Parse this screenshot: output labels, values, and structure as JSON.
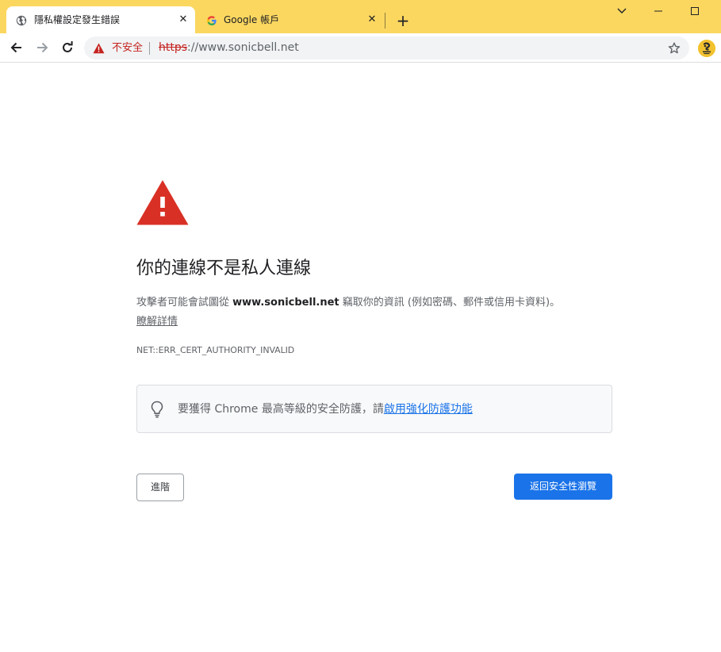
{
  "tabs": [
    {
      "title": "隱私權設定發生錯誤",
      "icon": "globe-icon",
      "active": true
    },
    {
      "title": "Google 帳戶",
      "icon": "google-g-icon",
      "active": false
    }
  ],
  "toolbar": {
    "security_label": "不安全",
    "url_scheme": "https",
    "url_rest": "://www.sonicbell.net"
  },
  "interstitial": {
    "heading": "你的連線不是私人連線",
    "explanation_before": "攻擊者可能會試圖從 ",
    "explanation_host": "www.sonicbell.net",
    "explanation_after": " 竊取你的資訊 (例如密碼、郵件或信用卡資料)。",
    "learn_more": "瞭解詳情",
    "error_code": "NET::ERR_CERT_AUTHORITY_INVALID",
    "promo_text": "要獲得 Chrome 最高等級的安全防護，請",
    "promo_link": "啟用強化防護功能",
    "advanced_button": "進階",
    "back_button": "返回安全性瀏覽"
  },
  "colors": {
    "tabstrip": "#fbd760",
    "warning_red": "#d93025",
    "primary_blue": "#1a73e8",
    "insecure_red": "#c5221f"
  }
}
